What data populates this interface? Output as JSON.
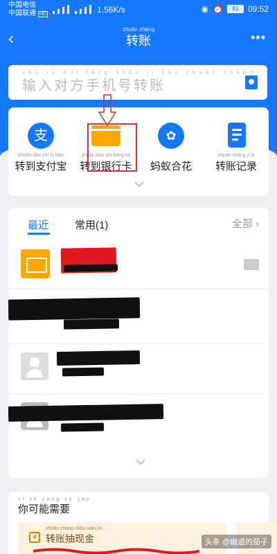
{
  "status_bar": {
    "carrier_1": "中国电信",
    "carrier_2": "中国联通",
    "hd_badge": "HD",
    "speed": "1.56K/s",
    "battery": "81",
    "time": "09:52"
  },
  "header": {
    "title_pinyin": "zhuǎn zhàng",
    "title": "转账"
  },
  "search": {
    "pinyin": "shū rù duì fāng shǒu jī hào zhuǎn zhàng",
    "placeholder": "输入对方手机号转账"
  },
  "actions": [
    {
      "label": "转到支付宝",
      "icon": "alipay-icon",
      "pinyin": "zhuǎn dào zhī fù bǎo"
    },
    {
      "label": "转到银行卡",
      "icon": "bank-card-icon",
      "pinyin": "zhuǎn dào yín háng kǎ"
    },
    {
      "label": "蚂蚁合花",
      "icon": "ant-icon",
      "pinyin": ""
    },
    {
      "label": "转账记录",
      "icon": "record-icon",
      "pinyin": "zhuǎn zhàng jì lù"
    }
  ],
  "recent": {
    "tab_recent": "最近",
    "tab_common": "常用(1)",
    "all_link": "全部 ›",
    "rows": 4
  },
  "suggest": {
    "pinyin": "nǐ kě néng xū yào",
    "title": "你可能需要",
    "promo_pinyin": "zhuǎn zhàng chōu xiàn jīn",
    "promo_title": "转账抽现金"
  },
  "watermark": "头条 @幽道的茄子",
  "colors": {
    "primary": "#1677ff",
    "accent_orange": "#f8a800",
    "annotation_red": "#d42e2e"
  }
}
